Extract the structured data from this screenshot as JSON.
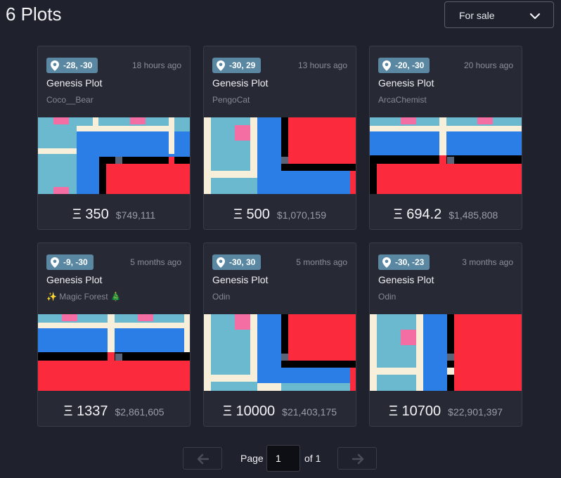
{
  "header": {
    "title": "6 Plots"
  },
  "filter": {
    "selected": "For sale"
  },
  "plots": [
    {
      "coords": "-28, -30",
      "time": "18 hours ago",
      "name": "Genesis Plot",
      "owner": "Coco__Bear",
      "price_eth": "Ξ 350",
      "price_usd": "$749,111"
    },
    {
      "coords": "-30, 29",
      "time": "13 hours ago",
      "name": "Genesis Plot",
      "owner": "PengoCat",
      "price_eth": "Ξ 500",
      "price_usd": "$1,070,159"
    },
    {
      "coords": "-20, -30",
      "time": "20 hours ago",
      "name": "Genesis Plot",
      "owner": "ArcaChemist",
      "price_eth": "Ξ 694.2",
      "price_usd": "$1,485,808"
    },
    {
      "coords": "-9, -30",
      "time": "5 months ago",
      "name": "Genesis Plot",
      "owner": "✨ Magic Forest 🎄",
      "price_eth": "Ξ 1337",
      "price_usd": "$2,861,605"
    },
    {
      "coords": "-30, 30",
      "time": "5 months ago",
      "name": "Genesis Plot",
      "owner": "Odin",
      "price_eth": "Ξ 10000",
      "price_usd": "$21,403,175"
    },
    {
      "coords": "-30, -23",
      "time": "3 months ago",
      "name": "Genesis Plot",
      "owner": "Odin",
      "price_eth": "Ξ 10700",
      "price_usd": "$22,901,397"
    }
  ],
  "pagination": {
    "page_label": "Page",
    "current": "1",
    "of_label": "of 1"
  },
  "colors": {
    "background": "#1f222d",
    "card": "#272a35",
    "coord_badge": "#5a88a3",
    "map_water": "#6bb9cf",
    "map_blue": "#2b7ee6",
    "map_red": "#fb2a3c",
    "map_road": "#f7efd9",
    "map_pink": "#f56ea3"
  }
}
